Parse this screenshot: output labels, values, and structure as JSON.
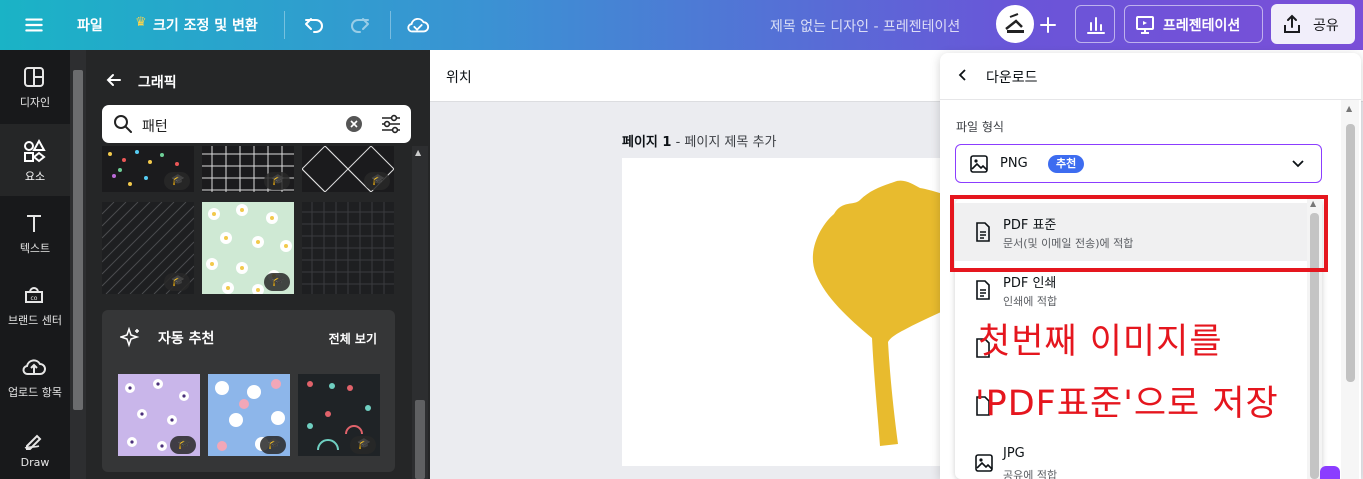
{
  "topbar": {
    "file_menu": "파일",
    "resize_menu": "크기 조정 및 변환",
    "doc_title": "제목 없는 디자인 - 프레젠테이션",
    "present_label": "프레젠테이션",
    "share_label": "공유"
  },
  "rail": {
    "items": [
      {
        "label": "디자인"
      },
      {
        "label": "요소"
      },
      {
        "label": "텍스트"
      },
      {
        "label": "브랜드 센터"
      },
      {
        "label": "업로드 항목"
      },
      {
        "label": "Draw"
      }
    ]
  },
  "panel": {
    "title": "그래픽",
    "search_value": "패턴",
    "auto_rec_title": "자동 추천",
    "view_all": "전체 보기"
  },
  "workspace": {
    "position_label": "위치",
    "page_number": "페이지 1",
    "page_title_placeholder": "- 페이지 제목 추가"
  },
  "download": {
    "title": "다운로드",
    "format_label": "파일 형식",
    "format_value": "PNG",
    "format_badge": "추천",
    "options": [
      {
        "name": "PDF 표준",
        "desc": "문서(및 이메일 전송)에 적합"
      },
      {
        "name": "PDF 인쇄",
        "desc": "인쇄에 적합"
      },
      {
        "name": "JPG",
        "desc": "공유에 적합"
      }
    ]
  },
  "annotation": {
    "line1": "첫번째 이미지를",
    "line2": "'PDF표준'으로 저장"
  },
  "colors": {
    "accent": "#8b3dff",
    "annotation_red": "#e5161e",
    "leaf": "#e8bb2e",
    "badge_blue": "#3d6cf0"
  }
}
